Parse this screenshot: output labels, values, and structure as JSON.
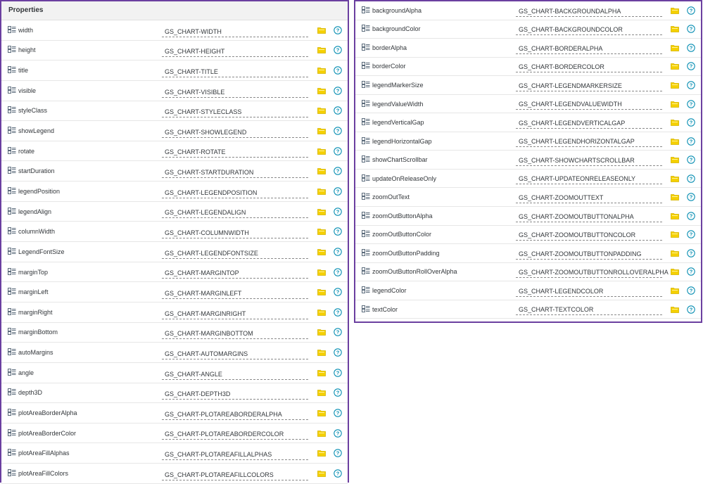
{
  "left_panel": {
    "header": "Properties",
    "rows": [
      {
        "name": "width",
        "value": "GS_CHART-WIDTH"
      },
      {
        "name": "height",
        "value": "GS_CHART-HEIGHT"
      },
      {
        "name": "title",
        "value": "GS_CHART-TITLE"
      },
      {
        "name": "visible",
        "value": "GS_CHART-VISIBLE"
      },
      {
        "name": "styleClass",
        "value": "GS_CHART-STYLECLASS"
      },
      {
        "name": "showLegend",
        "value": "GS_CHART-SHOWLEGEND"
      },
      {
        "name": "rotate",
        "value": "GS_CHART-ROTATE"
      },
      {
        "name": "startDuration",
        "value": "GS_CHART-STARTDURATION"
      },
      {
        "name": "legendPosition",
        "value": "GS_CHART-LEGENDPOSITION"
      },
      {
        "name": "legendAlign",
        "value": "GS_CHART-LEGENDALIGN"
      },
      {
        "name": "columnWidth",
        "value": "GS_CHART-COLUMNWIDTH"
      },
      {
        "name": "LegendFontSize",
        "value": "GS_CHART-LEGENDFONTSIZE"
      },
      {
        "name": "marginTop",
        "value": "GS_CHART-MARGINTOP"
      },
      {
        "name": "marginLeft",
        "value": "GS_CHART-MARGINLEFT"
      },
      {
        "name": "marginRight",
        "value": "GS_CHART-MARGINRIGHT"
      },
      {
        "name": "marginBottom",
        "value": "GS_CHART-MARGINBOTTOM"
      },
      {
        "name": "autoMargins",
        "value": "GS_CHART-AUTOMARGINS"
      },
      {
        "name": "angle",
        "value": "GS_CHART-ANGLE"
      },
      {
        "name": "depth3D",
        "value": "GS_CHART-DEPTH3D"
      },
      {
        "name": "plotAreaBorderAlpha",
        "value": "GS_CHART-PLOTAREABORDERALPHA"
      },
      {
        "name": "plotAreaBorderColor",
        "value": "GS_CHART-PLOTAREABORDERCOLOR"
      },
      {
        "name": "plotAreaFillAlphas",
        "value": "GS_CHART-PLOTAREAFILLALPHAS"
      },
      {
        "name": "plotAreaFillColors",
        "value": "GS_CHART-PLOTAREAFILLCOLORS"
      }
    ]
  },
  "right_panel": {
    "rows": [
      {
        "name": "backgroundAlpha",
        "value": "GS_CHART-BACKGROUNDALPHA"
      },
      {
        "name": "backgroundColor",
        "value": "GS_CHART-BACKGROUNDCOLOR"
      },
      {
        "name": "borderAlpha",
        "value": "GS_CHART-BORDERALPHA"
      },
      {
        "name": "borderColor",
        "value": "GS_CHART-BORDERCOLOR"
      },
      {
        "name": "legendMarkerSize",
        "value": "GS_CHART-LEGENDMARKERSIZE"
      },
      {
        "name": "legendValueWidth",
        "value": "GS_CHART-LEGENDVALUEWIDTH"
      },
      {
        "name": "legendVerticalGap",
        "value": "GS_CHART-LEGENDVERTICALGAP"
      },
      {
        "name": "legendHorizontalGap",
        "value": "GS_CHART-LEGENDHORIZONTALGAP"
      },
      {
        "name": "showChartScrollbar",
        "value": "GS_CHART-SHOWCHARTSCROLLBAR"
      },
      {
        "name": "updateOnReleaseOnly",
        "value": "GS_CHART-UPDATEONRELEASEONLY"
      },
      {
        "name": "zoomOutText",
        "value": "GS_CHART-ZOOMOUTTEXT"
      },
      {
        "name": "zoomOutButtonAlpha",
        "value": "GS_CHART-ZOOMOUTBUTTONALPHA"
      },
      {
        "name": "zoomOutButtonColor",
        "value": "GS_CHART-ZOOMOUTBUTTONCOLOR"
      },
      {
        "name": "zoomOutButtonPadding",
        "value": "GS_CHART-ZOOMOUTBUTTONPADDING"
      },
      {
        "name": "zoomOutButtonRollOverAlpha",
        "value": "GS_CHART-ZOOMOUTBUTTONROLLOVERALPHA"
      },
      {
        "name": "legendColor",
        "value": "GS_CHART-LEGENDCOLOR"
      },
      {
        "name": "textColor",
        "value": "GS_CHART-TEXTCOLOR"
      }
    ]
  },
  "icons": {
    "property": "property-binding-icon",
    "folder": "folder-icon",
    "help": "help-icon"
  },
  "colors": {
    "panel_border": "#6b3fa0",
    "folder_yellow": "#f5d000",
    "help_teal": "#0a8fb3"
  }
}
